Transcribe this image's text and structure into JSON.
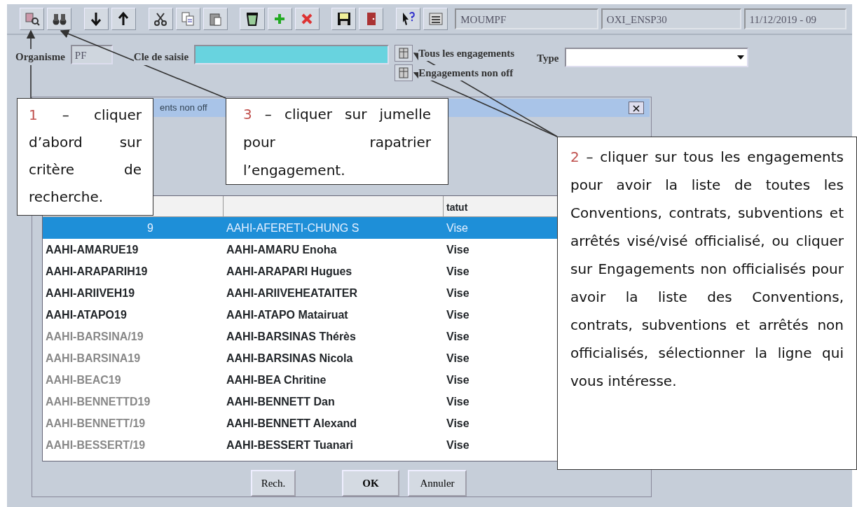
{
  "toolbar": {
    "tools": [
      {
        "kind": "query"
      },
      {
        "kind": "binoculars"
      },
      {
        "kind": "down"
      },
      {
        "kind": "up"
      },
      {
        "kind": "cut"
      },
      {
        "kind": "copy"
      },
      {
        "kind": "paste"
      },
      {
        "kind": "trash"
      },
      {
        "kind": "add"
      },
      {
        "kind": "delete"
      },
      {
        "kind": "save"
      },
      {
        "kind": "exit"
      },
      {
        "kind": "help"
      },
      {
        "kind": "list"
      }
    ],
    "info_fields": [
      "MOUMPF",
      "OXI_ENSP30",
      "11/12/2019 - 09"
    ]
  },
  "form": {
    "organisme_label": "Organisme",
    "organisme_value": "PF",
    "cle_label": "Cle de saisie",
    "options": [
      {
        "label": "Tous les engagements"
      },
      {
        "label": "Engagements non off"
      }
    ],
    "type_label": "Type"
  },
  "dialog": {
    "title": "ents non off",
    "columns": [
      "",
      "",
      "tatut"
    ],
    "rows": [
      {
        "cells": [
          "9",
          "AAHI-AFERETI-CHUNG S",
          "Vise"
        ],
        "selected": true,
        "dimmed": false
      },
      {
        "cells": [
          "AAHI-AMARUE19",
          "AAHI-AMARU Enoha",
          "Vise"
        ],
        "selected": false,
        "dimmed": false
      },
      {
        "cells": [
          "AAHI-ARAPARIH19",
          "AAHI-ARAPARI Hugues",
          "Vise"
        ],
        "selected": false,
        "dimmed": false
      },
      {
        "cells": [
          "AAHI-ARIIVEH19",
          "AAHI-ARIIVEHEATAITER",
          "Vise"
        ],
        "selected": false,
        "dimmed": false
      },
      {
        "cells": [
          "AAHI-ATAPO19",
          "AAHI-ATAPO Matairuat",
          "Vise"
        ],
        "selected": false,
        "dimmed": false
      },
      {
        "cells": [
          "AAHI-BARSINA/19",
          "AAHI-BARSINAS Thérès",
          "Vise"
        ],
        "selected": false,
        "dimmed": true
      },
      {
        "cells": [
          "AAHI-BARSINA19",
          "AAHI-BARSINAS Nicola",
          "Vise"
        ],
        "selected": false,
        "dimmed": true
      },
      {
        "cells": [
          "AAHI-BEAC19",
          "AAHI-BEA Chritine",
          "Vise"
        ],
        "selected": false,
        "dimmed": true
      },
      {
        "cells": [
          "AAHI-BENNETTD19",
          "AAHI-BENNETT Dan",
          "Vise"
        ],
        "selected": false,
        "dimmed": true
      },
      {
        "cells": [
          "AAHI-BENNETT/19",
          "AAHI-BENNETT Alexand",
          "Vise"
        ],
        "selected": false,
        "dimmed": true
      },
      {
        "cells": [
          "AAHI-BESSERT/19",
          "AAHI-BESSERT Tuanari",
          "Vise"
        ],
        "selected": false,
        "dimmed": true
      }
    ],
    "buttons": [
      "Rech.",
      "OK",
      "Annuler"
    ]
  },
  "callouts": [
    {
      "number": "1",
      "text": "– cliquer d’abord sur critère de recherche."
    },
    {
      "number": "3",
      "text": "– cliquer sur jumelle pour rapatrier l’engagement."
    },
    {
      "number": "2",
      "text": "– cliquer sur tous les engagements pour avoir la liste de toutes les Conventions, contrats, subventions et arrêtés visé/visé officialisé, ou cliquer sur Engagements non officialisés pour avoir la liste des Conventions, contrats, subventions et arrêtés non officialisés, sélectionner la ligne qui vous intéresse."
    }
  ]
}
